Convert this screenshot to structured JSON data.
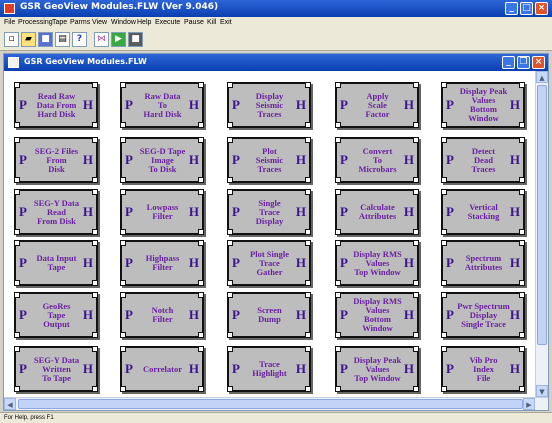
{
  "app": {
    "title": "GSR GeoView Modules.FLW (Ver 9.046)"
  },
  "menu": [
    "File",
    "Processing",
    "Tape",
    "Parms",
    "View",
    "Window",
    "Help",
    "Execute",
    "Pause",
    "Kill",
    "Exit"
  ],
  "toolbar": [
    "new-doc",
    "open-folder",
    "save",
    "print",
    "help",
    "spectrum",
    "run",
    "stop"
  ],
  "child": {
    "title": "GSR GeoView Modules.FLW"
  },
  "ports": {
    "in": "P",
    "out": "H"
  },
  "modules": [
    [
      "Read Raw\nData From\nHard Disk",
      "Raw Data\nTo\nHard Disk",
      "Display\nSeismic\nTraces",
      "Apply\nScale\nFactor",
      "Display Peak\nValues\nBottom Window"
    ],
    [
      "SEG-2 Files\nFrom\nDisk",
      "SEG-D Tape\nImage\nTo Disk",
      "Plot\nSeismic\nTraces",
      "Convert\nTo\nMicrobars",
      "Detect\nDead\nTraces"
    ],
    [
      "SEG-Y Data\nRead\nFrom Disk",
      "Lowpass\nFilter",
      "Single\nTrace\nDisplay",
      "Calculate\nAttributes",
      "Vertical\nStacking"
    ],
    [
      "Data Input\nTape",
      "Highpass\nFilter",
      "Plot Single\nTrace\nGather",
      "Display RMS\nValues\nTop Window",
      "Spectrum\nAttributes"
    ],
    [
      "GeoRes\nTape\nOutput",
      "Notch\nFilter",
      "Screen\nDump",
      "Display RMS\nValues\nBottom Window",
      "Pwr Spectrum\nDisplay\nSingle Trace"
    ],
    [
      "SEG-Y Data\nWritten\nTo Tape",
      "Correlator",
      "Trace\nHighlight",
      "Display Peak\nValues\nTop Window",
      "Vib Pro\nIndex\nFile"
    ]
  ],
  "status": {
    "text": "For Help, press F1"
  }
}
